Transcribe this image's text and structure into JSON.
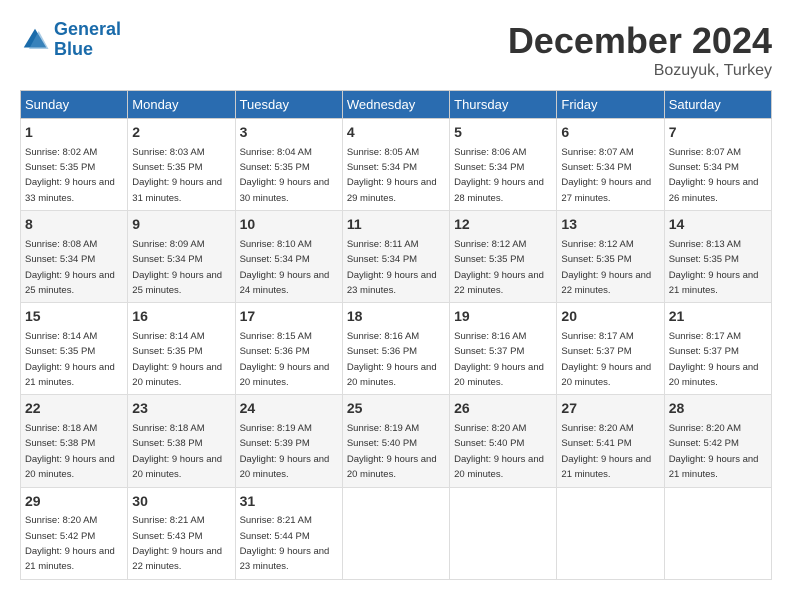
{
  "header": {
    "logo_line1": "General",
    "logo_line2": "Blue",
    "month_title": "December 2024",
    "location": "Bozuyuk, Turkey"
  },
  "days_of_week": [
    "Sunday",
    "Monday",
    "Tuesday",
    "Wednesday",
    "Thursday",
    "Friday",
    "Saturday"
  ],
  "weeks": [
    [
      {
        "day": "1",
        "sunrise": "8:02 AM",
        "sunset": "5:35 PM",
        "daylight": "9 hours and 33 minutes."
      },
      {
        "day": "2",
        "sunrise": "8:03 AM",
        "sunset": "5:35 PM",
        "daylight": "9 hours and 31 minutes."
      },
      {
        "day": "3",
        "sunrise": "8:04 AM",
        "sunset": "5:35 PM",
        "daylight": "9 hours and 30 minutes."
      },
      {
        "day": "4",
        "sunrise": "8:05 AM",
        "sunset": "5:34 PM",
        "daylight": "9 hours and 29 minutes."
      },
      {
        "day": "5",
        "sunrise": "8:06 AM",
        "sunset": "5:34 PM",
        "daylight": "9 hours and 28 minutes."
      },
      {
        "day": "6",
        "sunrise": "8:07 AM",
        "sunset": "5:34 PM",
        "daylight": "9 hours and 27 minutes."
      },
      {
        "day": "7",
        "sunrise": "8:07 AM",
        "sunset": "5:34 PM",
        "daylight": "9 hours and 26 minutes."
      }
    ],
    [
      {
        "day": "8",
        "sunrise": "8:08 AM",
        "sunset": "5:34 PM",
        "daylight": "9 hours and 25 minutes."
      },
      {
        "day": "9",
        "sunrise": "8:09 AM",
        "sunset": "5:34 PM",
        "daylight": "9 hours and 25 minutes."
      },
      {
        "day": "10",
        "sunrise": "8:10 AM",
        "sunset": "5:34 PM",
        "daylight": "9 hours and 24 minutes."
      },
      {
        "day": "11",
        "sunrise": "8:11 AM",
        "sunset": "5:34 PM",
        "daylight": "9 hours and 23 minutes."
      },
      {
        "day": "12",
        "sunrise": "8:12 AM",
        "sunset": "5:35 PM",
        "daylight": "9 hours and 22 minutes."
      },
      {
        "day": "13",
        "sunrise": "8:12 AM",
        "sunset": "5:35 PM",
        "daylight": "9 hours and 22 minutes."
      },
      {
        "day": "14",
        "sunrise": "8:13 AM",
        "sunset": "5:35 PM",
        "daylight": "9 hours and 21 minutes."
      }
    ],
    [
      {
        "day": "15",
        "sunrise": "8:14 AM",
        "sunset": "5:35 PM",
        "daylight": "9 hours and 21 minutes."
      },
      {
        "day": "16",
        "sunrise": "8:14 AM",
        "sunset": "5:35 PM",
        "daylight": "9 hours and 20 minutes."
      },
      {
        "day": "17",
        "sunrise": "8:15 AM",
        "sunset": "5:36 PM",
        "daylight": "9 hours and 20 minutes."
      },
      {
        "day": "18",
        "sunrise": "8:16 AM",
        "sunset": "5:36 PM",
        "daylight": "9 hours and 20 minutes."
      },
      {
        "day": "19",
        "sunrise": "8:16 AM",
        "sunset": "5:37 PM",
        "daylight": "9 hours and 20 minutes."
      },
      {
        "day": "20",
        "sunrise": "8:17 AM",
        "sunset": "5:37 PM",
        "daylight": "9 hours and 20 minutes."
      },
      {
        "day": "21",
        "sunrise": "8:17 AM",
        "sunset": "5:37 PM",
        "daylight": "9 hours and 20 minutes."
      }
    ],
    [
      {
        "day": "22",
        "sunrise": "8:18 AM",
        "sunset": "5:38 PM",
        "daylight": "9 hours and 20 minutes."
      },
      {
        "day": "23",
        "sunrise": "8:18 AM",
        "sunset": "5:38 PM",
        "daylight": "9 hours and 20 minutes."
      },
      {
        "day": "24",
        "sunrise": "8:19 AM",
        "sunset": "5:39 PM",
        "daylight": "9 hours and 20 minutes."
      },
      {
        "day": "25",
        "sunrise": "8:19 AM",
        "sunset": "5:40 PM",
        "daylight": "9 hours and 20 minutes."
      },
      {
        "day": "26",
        "sunrise": "8:20 AM",
        "sunset": "5:40 PM",
        "daylight": "9 hours and 20 minutes."
      },
      {
        "day": "27",
        "sunrise": "8:20 AM",
        "sunset": "5:41 PM",
        "daylight": "9 hours and 21 minutes."
      },
      {
        "day": "28",
        "sunrise": "8:20 AM",
        "sunset": "5:42 PM",
        "daylight": "9 hours and 21 minutes."
      }
    ],
    [
      {
        "day": "29",
        "sunrise": "8:20 AM",
        "sunset": "5:42 PM",
        "daylight": "9 hours and 21 minutes."
      },
      {
        "day": "30",
        "sunrise": "8:21 AM",
        "sunset": "5:43 PM",
        "daylight": "9 hours and 22 minutes."
      },
      {
        "day": "31",
        "sunrise": "8:21 AM",
        "sunset": "5:44 PM",
        "daylight": "9 hours and 23 minutes."
      },
      null,
      null,
      null,
      null
    ]
  ]
}
